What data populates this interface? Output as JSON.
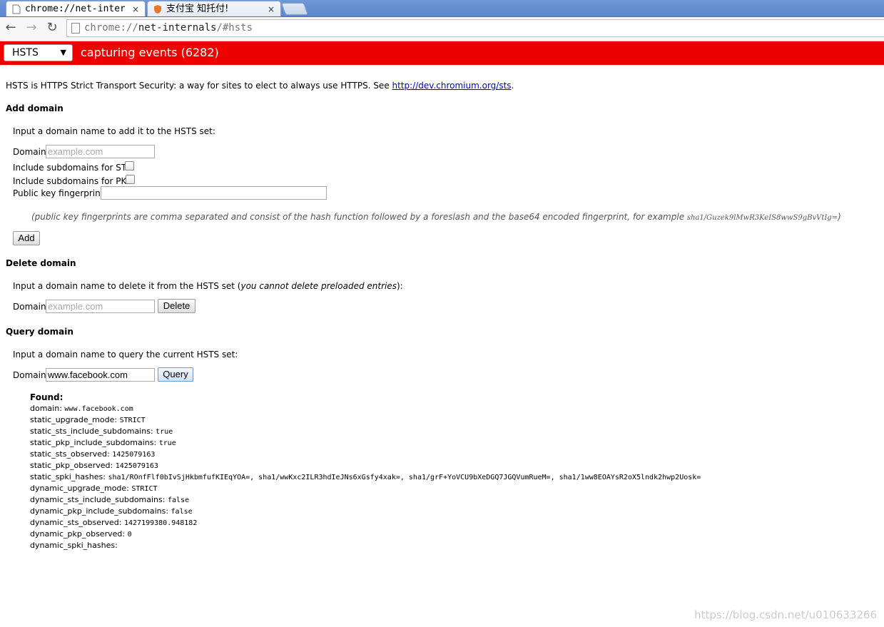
{
  "tabs": [
    {
      "title": "chrome://net-inter",
      "close": "×"
    },
    {
      "title": "支付宝 知托付!",
      "close": "×"
    }
  ],
  "toolbar": {
    "back": "←",
    "forward": "→",
    "reload": "↻",
    "url_scheme": "chrome://",
    "url_host": "net-internals",
    "url_path": "/#hsts"
  },
  "header": {
    "select_value": "HSTS",
    "select_arrow": "▼",
    "status": "capturing events (6282)",
    "bar_color": "#ee0000"
  },
  "intro": {
    "text": "HSTS is HTTPS Strict Transport Security: a way for sites to elect to always use HTTPS. See ",
    "link": "http://dev.chromium.org/sts",
    "period": "."
  },
  "add": {
    "heading": "Add domain",
    "instruction": "Input a domain name to add it to the HSTS set:",
    "domain_label": "Domain:",
    "domain_placeholder": "example.com",
    "sts_label": "Include subdomains for STS:",
    "pkp_label": "Include subdomains for PKP:",
    "pk_label": "Public key fingerprints:",
    "note": "(public key fingerprints are comma separated and consist of the hash function followed by a foreslash and the base64 encoded fingerprint, for example ",
    "example": "sha1/Guzek9lMwR3KeIS8wwS9gBvVtIg=",
    "note_end": ")",
    "button": "Add"
  },
  "delete": {
    "heading": "Delete domain",
    "instruction_a": "Input a domain name to delete it from the HSTS set (",
    "instruction_em": "you cannot delete preloaded entries",
    "instruction_b": "):",
    "domain_label": "Domain:",
    "domain_placeholder": "example.com",
    "button": "Delete"
  },
  "query": {
    "heading": "Query domain",
    "instruction": "Input a domain name to query the current HSTS set:",
    "domain_label": "Domain:",
    "domain_value": "www.facebook.com",
    "button": "Query"
  },
  "result": {
    "found": "Found:",
    "rows": [
      {
        "key": "domain:",
        "value": "www.facebook.com"
      },
      {
        "key": "static_upgrade_mode:",
        "value": "STRICT"
      },
      {
        "key": "static_sts_include_subdomains:",
        "value": "true"
      },
      {
        "key": "static_pkp_include_subdomains:",
        "value": "true"
      },
      {
        "key": "static_sts_observed:",
        "value": "1425079163"
      },
      {
        "key": "static_pkp_observed:",
        "value": "1425079163"
      },
      {
        "key": "static_spki_hashes:",
        "value": "sha1/ROnfFlf0bIvSjHkbmfufKIEqYOA=, sha1/wwKxc2ILR3hdIeJNs6xGsfy4xak=, sha1/grF+YoVCU9bXeDGQ7JGQVumRueM=, sha1/1ww8EOAYsR2oX5lndk2hwp2Uosk="
      },
      {
        "key": "dynamic_upgrade_mode:",
        "value": "STRICT"
      },
      {
        "key": "dynamic_sts_include_subdomains:",
        "value": "false"
      },
      {
        "key": "dynamic_pkp_include_subdomains:",
        "value": "false"
      },
      {
        "key": "dynamic_sts_observed:",
        "value": "1427199380.948182"
      },
      {
        "key": "dynamic_pkp_observed:",
        "value": "0"
      },
      {
        "key": "dynamic_spki_hashes:",
        "value": ""
      }
    ]
  },
  "watermark": "https://blog.csdn.net/u010633266"
}
